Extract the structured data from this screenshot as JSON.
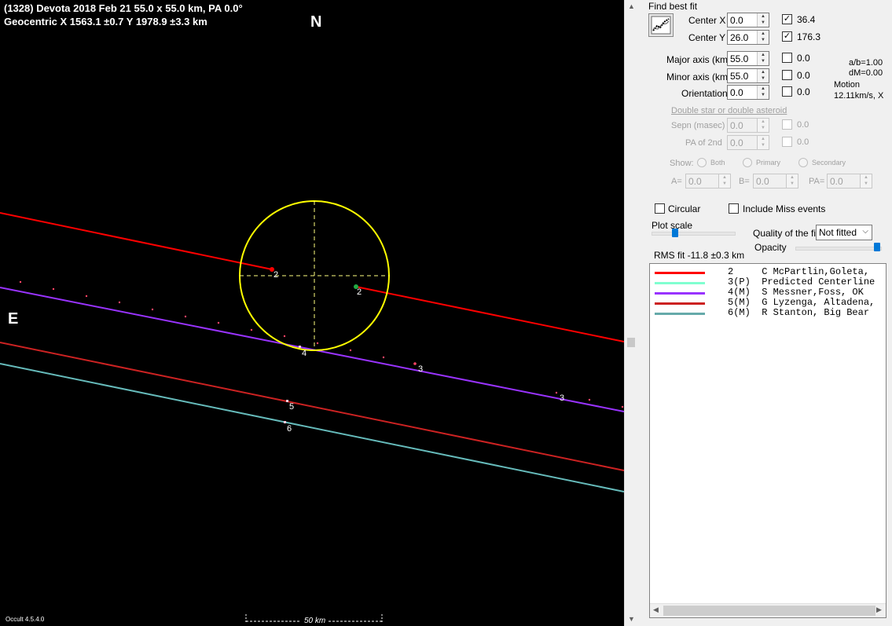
{
  "plot": {
    "title_line1": "(1328) Devota  2018 Feb 21   55.0 x 55.0 km, PA 0.0°",
    "title_line2": "Geocentric  X  1563.1 ±0.7  Y 1978.9 ±3.3 km",
    "north_label": "N",
    "east_label": "E",
    "version": "Occult 4.5.4.0",
    "scale_label": "50 km",
    "chord_labels": [
      "2",
      "2",
      "4",
      "3",
      "3",
      "5",
      "6"
    ],
    "colors": {
      "background": "#000000",
      "ellipse": "#ffff00",
      "chord2": "#ff0000",
      "chord4": "#9933ff",
      "chord5": "#cc2222",
      "chord6": "#66bbbb",
      "predicted_dots": "#ff4466"
    }
  },
  "panel": {
    "find_best_fit": "Find best fit",
    "center_x": {
      "label": "Center X",
      "value": "0.0",
      "checked": true,
      "result": "36.4"
    },
    "center_y": {
      "label": "Center Y",
      "value": "26.0",
      "checked": true,
      "result": "176.3"
    },
    "major_axis": {
      "label": "Major axis (km)",
      "value": "55.0",
      "checked": false,
      "result": "0.0"
    },
    "minor_axis": {
      "label": "Minor axis (km)",
      "value": "55.0",
      "checked": false,
      "result": "0.0"
    },
    "orientation": {
      "label": "Orientation",
      "value": "0.0",
      "checked": false,
      "result": "0.0"
    },
    "ab_ratio": "a/b=1.00",
    "dm": "dM=0.00",
    "motion_label": "Motion",
    "motion_value": "12.11km/s, X",
    "double_star": "Double star  or  double asteroid",
    "sepn": {
      "label": "Sepn (masec)",
      "value": "0.0",
      "result": "0.0"
    },
    "pa2": {
      "label": "PA of 2nd",
      "value": "0.0",
      "result": "0.0"
    },
    "show_label": "Show:",
    "show_options": [
      "Both",
      "Primary",
      "Secondary"
    ],
    "a_label": "A=",
    "a_value": "0.0",
    "b_label": "B=",
    "b_value": "0.0",
    "pa_label": "PA=",
    "pa_value": "0.0",
    "circular": "Circular",
    "include_miss": "Include Miss events",
    "plot_scale": "Plot scale",
    "quality_label": "Quality of the fit",
    "quality_value": "Not fitted",
    "opacity": "Opacity",
    "rms_fit": "RMS fit -11.8 ±0.3 km",
    "legend": [
      {
        "text": "2     C McPartlin,Goleta,",
        "color": "#ff0000"
      },
      {
        "text": "3(P)  Predicted Centerline",
        "color": "#80ffd0"
      },
      {
        "text": "4(M)  S Messner,Foss, OK",
        "color": "#9933ff"
      },
      {
        "text": "5(M)  G Lyzenga, Altadena,",
        "color": "#cc2222"
      },
      {
        "text": "6(M)  R Stanton, Big Bear",
        "color": "#66aaaa"
      }
    ]
  }
}
